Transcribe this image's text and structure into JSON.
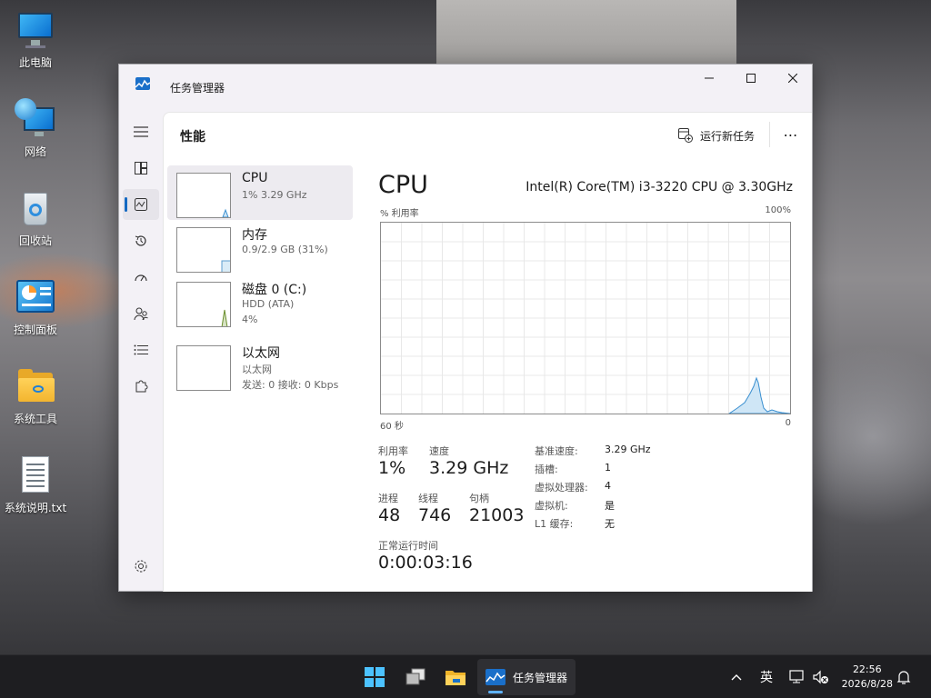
{
  "desktop": {
    "icons": [
      {
        "label": "此电脑",
        "icon": "computer-icon"
      },
      {
        "label": "网络",
        "icon": "network-icon"
      },
      {
        "label": "回收站",
        "icon": "recycle-bin-icon"
      },
      {
        "label": "控制面板",
        "icon": "control-panel-icon"
      },
      {
        "label": "系统工具",
        "icon": "folder-icon"
      },
      {
        "label": "系统说明.txt",
        "icon": "text-file-icon"
      }
    ]
  },
  "window": {
    "title": "任务管理器",
    "controls": {
      "minimize": "minimize",
      "maximize": "maximize",
      "close": "close"
    },
    "nav": [
      "menu",
      "processes",
      "performance",
      "app-history",
      "startup-apps",
      "users",
      "details",
      "services",
      "settings"
    ],
    "section_title": "性能",
    "toolbar": {
      "run_new_task": "运行新任务",
      "more": "⋯"
    },
    "resources": [
      {
        "name": "CPU",
        "sub1": "1% 3.29 GHz",
        "sub2": ""
      },
      {
        "name": "内存",
        "sub1": "0.9/2.9 GB (31%)",
        "sub2": ""
      },
      {
        "name": "磁盘 0 (C:)",
        "sub1": "HDD (ATA)",
        "sub2": "4%"
      },
      {
        "name": "以太网",
        "sub1": "以太网",
        "sub2": "发送: 0 接收: 0 Kbps"
      }
    ],
    "cpu": {
      "heading": "CPU",
      "model": "Intel(R) Core(TM) i3-3220 CPU @ 3.30GHz",
      "graph_top_label": "% 利用率",
      "graph_max_label": "100%",
      "graph_left_label": "60 秒",
      "graph_right_label": "0",
      "stats": {
        "utilization_label": "利用率",
        "utilization": "1%",
        "speed_label": "速度",
        "speed": "3.29 GHz",
        "processes_label": "进程",
        "processes": "48",
        "threads_label": "线程",
        "threads": "746",
        "handles_label": "句柄",
        "handles": "21003",
        "uptime_label": "正常运行时间",
        "uptime": "0:00:03:16"
      },
      "specs": [
        {
          "label": "基准速度:",
          "value": "3.29 GHz"
        },
        {
          "label": "插槽:",
          "value": "1"
        },
        {
          "label": "虚拟处理器:",
          "value": "4"
        },
        {
          "label": "虚拟机:",
          "value": "是"
        },
        {
          "label": "L1 缓存:",
          "value": "无"
        }
      ]
    }
  },
  "taskbar": {
    "apps": [
      {
        "name": "start",
        "icon": "windows-logo-icon"
      },
      {
        "name": "task-view",
        "icon": "task-view-icon"
      },
      {
        "name": "file-explorer",
        "icon": "folder-icon"
      },
      {
        "name": "task-manager",
        "icon": "task-manager-icon",
        "label": "任务管理器"
      }
    ],
    "tray": {
      "ime": "英"
    },
    "clock": {
      "time": "22:56",
      "date": "2026/8/28"
    }
  },
  "colors": {
    "accent": "#1469c2",
    "graph_line": "#3a8fd0",
    "graph_fill": "#cfe6f6",
    "taskbar": "#1e1e21"
  }
}
